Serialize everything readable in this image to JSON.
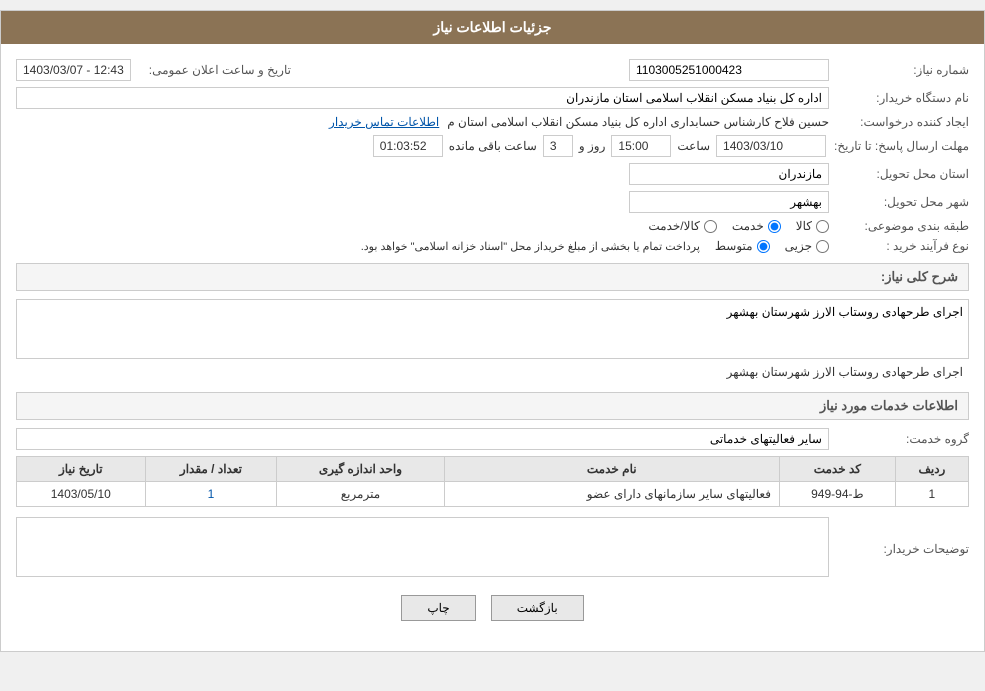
{
  "header": {
    "title": "جزئیات اطلاعات نیاز"
  },
  "form": {
    "need_number_label": "شماره نیاز:",
    "need_number_value": "1103005251000423",
    "buyer_org_label": "نام دستگاه خریدار:",
    "buyer_org_value": "اداره کل بنیاد مسکن انقلاب اسلامی استان مازندران",
    "creator_label": "ایجاد کننده درخواست:",
    "creator_value": "حسین فلاح کارشناس حسابداری اداره کل بنیاد مسکن انقلاب اسلامی استان م",
    "creator_link": "اطلاعات تماس خریدار",
    "send_date_label": "مهلت ارسال پاسخ: تا تاریخ:",
    "send_date_value": "1403/03/10",
    "send_time_label": "ساعت",
    "send_time_value": "15:00",
    "send_days_label": "روز و",
    "send_days_value": "3",
    "send_remaining_label": "ساعت باقی مانده",
    "send_remaining_value": "01:03:52",
    "announce_label": "تاریخ و ساعت اعلان عمومی:",
    "announce_value": "1403/03/07 - 12:43",
    "province_label": "استان محل تحویل:",
    "province_value": "مازندران",
    "city_label": "شهر محل تحویل:",
    "city_value": "بهشهر",
    "category_label": "طبقه بندی موضوعی:",
    "category_radio1": "کالا",
    "category_radio2": "خدمت",
    "category_radio3": "کالا/خدمت",
    "category_selected": "خدمت",
    "process_label": "نوع فرآیند خرید :",
    "process_radio1": "جزیی",
    "process_radio2": "متوسط",
    "process_note": "پرداخت تمام یا بخشی از مبلغ خریداز محل \"اسناد خزانه اسلامی\" خواهد بود.",
    "description_label": "شرح کلی نیاز:",
    "description_value": "اجرای طرحهادی روستاب الارز شهرستان بهشهر",
    "services_title": "اطلاعات خدمات مورد نیاز",
    "group_service_label": "گروه خدمت:",
    "group_service_value": "سایر فعالیتهای خدماتی",
    "table": {
      "headers": [
        "ردیف",
        "کد خدمت",
        "نام خدمت",
        "واحد اندازه گیری",
        "تعداد / مقدار",
        "تاریخ نیاز"
      ],
      "rows": [
        {
          "row": "1",
          "code": "ط-94-949",
          "name": "فعالیتهای سایر سازمانهای دارای عضو",
          "unit": "مترمربع",
          "quantity": "1",
          "date": "1403/05/10"
        }
      ]
    },
    "buyer_notes_label": "توضیحات خریدار:",
    "buyer_notes_value": "",
    "btn_print": "چاپ",
    "btn_back": "بازگشت"
  }
}
